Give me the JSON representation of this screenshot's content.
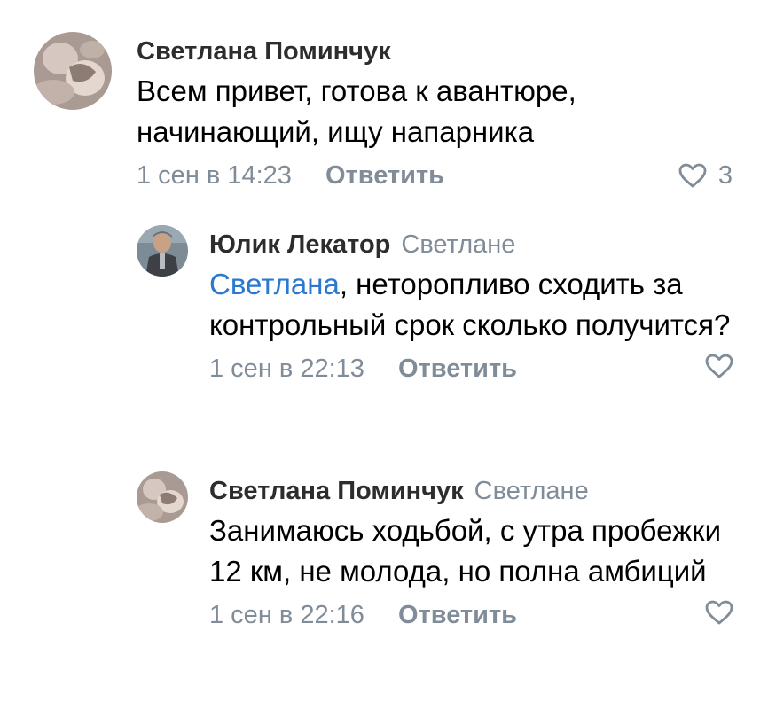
{
  "comments": [
    {
      "author": "Светлана Поминчук",
      "reply_to": "",
      "mention": "",
      "text": "Всем привет, готова к авантюре, начинающий, ищу напарника",
      "date": "1 сен в 14:23",
      "reply_label": "Ответить",
      "likes": "3",
      "avatar_icon": "avatar-photo-statue"
    },
    {
      "author": "Юлик Лекатор",
      "reply_to": "Светлане",
      "mention": "Светлана",
      "text": ", неторопливо сходить за контрольный срок сколько получится?",
      "date": "1 сен в 22:13",
      "reply_label": "Ответить",
      "likes": "",
      "avatar_icon": "avatar-photo-man"
    },
    {
      "author": "Светлана Поминчук",
      "reply_to": "Светлане",
      "mention": "",
      "text": "Занимаюсь ходьбой, с утра пробежки 12 км, не молода, но полна амбиций",
      "date": "1 сен в 22:16",
      "reply_label": "Ответить",
      "likes": "",
      "avatar_icon": "avatar-photo-statue"
    }
  ],
  "colors": {
    "secondary": "#818c99",
    "mention": "#2a78d0",
    "author": "#2c2d2e"
  }
}
